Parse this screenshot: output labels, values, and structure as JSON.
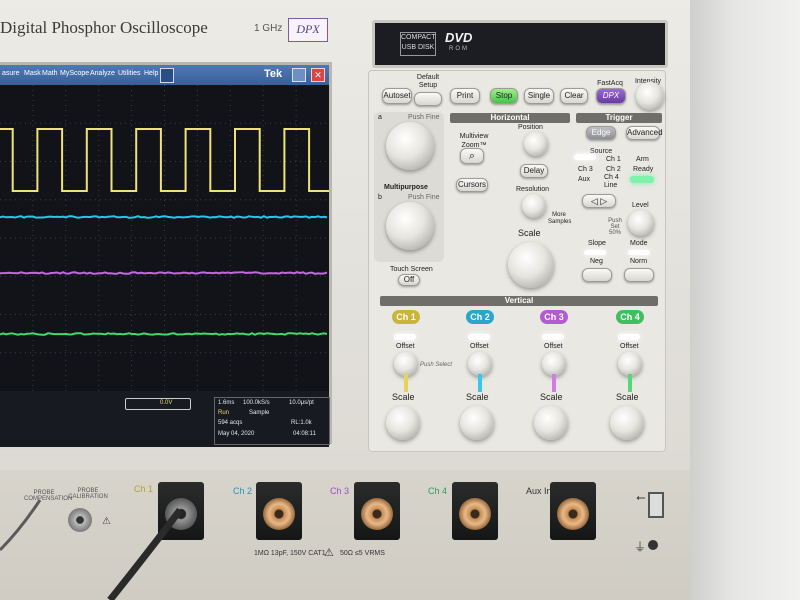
{
  "header": {
    "title": "Digital Phosphor Oscilloscope",
    "bandwidth": "1 GHz",
    "dpx_logo": "DPX"
  },
  "screen": {
    "menu": [
      "asure",
      "Mask",
      "Math",
      "MyScope",
      "Analyze",
      "Utilities",
      "Help"
    ],
    "brand": "Tek",
    "readout": {
      "cursor_box": "0.0V",
      "timebase": "1.6ms",
      "sample_rate": "100.0kS/s",
      "pts": "10.0μs/pt",
      "run": "Run",
      "mode": "Sample",
      "acqs": "594 acqs",
      "rl": "RL:1.0k",
      "date": "May 04, 2020",
      "time": "04:08:11"
    },
    "trace_colors": [
      "#f0e27a",
      "#27c7e6",
      "#c268e0",
      "#47d86c"
    ]
  },
  "dvd": {
    "usb": "COMPACT USB DISK",
    "logo": "DVD",
    "sub": "ROM"
  },
  "panel": {
    "top_buttons": [
      "Autoset",
      "Default Setup",
      "Print",
      "Stop",
      "Single",
      "Clear",
      "FastAcq",
      "Intensity"
    ],
    "fastacq_sub": "DPX",
    "multipurpose": {
      "a": "a",
      "b": "b",
      "push_fine_a": "Push Fine",
      "push_fine_b": "Push Fine",
      "label": "Multipurpose",
      "touch_screen": "Touch Screen",
      "off": "Off"
    },
    "horizontal": {
      "title": "Horizontal",
      "multiview": "Multiview Zoom™",
      "cursors": "Cursors",
      "position": "Position",
      "delay": "Delay",
      "resolution": "Resolution",
      "more_samples": "More Samples",
      "scale": "Scale"
    },
    "trigger": {
      "title": "Trigger",
      "edge": "Edge",
      "advanced": "Advanced",
      "source": "Source",
      "sources": [
        "Ch 1",
        "Ch 2",
        "Ch 3",
        "Ch 4",
        "Aux",
        "Line"
      ],
      "arm": "Arm",
      "ready": "Ready",
      "level": "Level",
      "push_set": "Push Set 50%",
      "slope": "Slope",
      "neg": "Neg",
      "mode": "Mode",
      "norm": "Norm"
    },
    "vertical": {
      "title": "Vertical",
      "channels": [
        "Ch 1",
        "Ch 2",
        "Ch 3",
        "Ch 4"
      ],
      "offset": "Offset",
      "push_select": "Push Select",
      "scale": "Scale",
      "channel_colors": [
        "#c9b53a",
        "#2aa6c9",
        "#b35bcf",
        "#3fbf5f"
      ]
    }
  },
  "front": {
    "probe_comp": "PROBE COMPENSATION",
    "probe_cal": "PROBE CALIBRATION",
    "channels": [
      "Ch 1",
      "Ch 2",
      "Ch 3",
      "Ch 4",
      "Aux In"
    ],
    "spec": "1MΩ 13pF, 150V CAT1",
    "spec2": "50Ω ≤5 VRMS"
  }
}
